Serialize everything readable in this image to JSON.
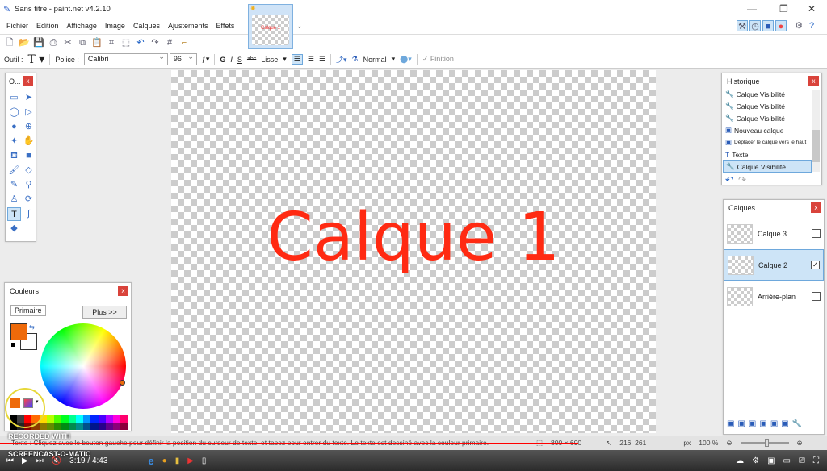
{
  "window": {
    "title": "Sans titre - paint.net v4.2.10",
    "image_tab_label": "Calque 1"
  },
  "menu": [
    "Fichier",
    "Edition",
    "Affichage",
    "Image",
    "Calques",
    "Ajustements",
    "Effets"
  ],
  "toolbar_icons": [
    "new-icon",
    "open-icon",
    "save-icon",
    "print-icon",
    "cut-icon",
    "copy-icon",
    "paste-icon",
    "crop-icon",
    "deselect-icon",
    "undo-icon",
    "redo-icon",
    "grid-icon",
    "ruler-icon"
  ],
  "tool_options": {
    "tool_label": "Outil :",
    "font_label": "Police :",
    "font": "Calibri",
    "size": "96",
    "bold": "G",
    "italic": "I",
    "underline": "S",
    "strike": "abc",
    "antialias": "Lisse",
    "blend": "Normal",
    "finish": "Finition"
  },
  "canvas": {
    "text": "Calque 1",
    "text_color": "#ff2a12"
  },
  "tools": {
    "title": "O...",
    "items": [
      "rectangle-select",
      "move-selection",
      "lasso-select",
      "move-selected",
      "ellipse-select",
      "zoom",
      "magic-wand",
      "pan",
      "paint-bucket",
      "gradient",
      "paintbrush",
      "eraser",
      "pencil",
      "color-picker",
      "clone-stamp",
      "recolor",
      "text",
      "line-curve",
      "shapes"
    ],
    "active": "text"
  },
  "colors": {
    "title": "Couleurs",
    "mode": "Primaire",
    "more": "Plus >>",
    "primary": "#ee6a0a",
    "secondary": "#ffffff",
    "palette": [
      "#000000",
      "#404040",
      "#ff0000",
      "#ff6a00",
      "#ffd800",
      "#b6ff00",
      "#4cff00",
      "#00ff21",
      "#00ff90",
      "#00ffff",
      "#0094ff",
      "#0026ff",
      "#4800ff",
      "#b200ff",
      "#ff00dc",
      "#ff006e"
    ]
  },
  "history": {
    "title": "Historique",
    "items": [
      {
        "icon": "wrench-icon",
        "label": "Calque Visibilité"
      },
      {
        "icon": "wrench-icon",
        "label": "Calque Visibilité"
      },
      {
        "icon": "wrench-icon",
        "label": "Calque Visibilité"
      },
      {
        "icon": "new-layer-icon",
        "label": "Nouveau calque"
      },
      {
        "icon": "move-layer-up-icon",
        "label": "Déplacer le calque vers le haut"
      },
      {
        "icon": "text-icon",
        "label": "Texte"
      },
      {
        "icon": "wrench-icon",
        "label": "Calque Visibilité"
      }
    ],
    "selected": 6
  },
  "layers": {
    "title": "Calques",
    "items": [
      {
        "name": "Calque 3",
        "visible": false
      },
      {
        "name": "Calque 2",
        "visible": true,
        "selected": true
      },
      {
        "name": "Arrière-plan",
        "visible": false
      }
    ]
  },
  "status": {
    "hint": "Texte : Cliquez avec le bouton gauche pour définir la position du curseur de texte, et tapez pour entrer du texte. Le texte est dessiné avec la couleur primaire.",
    "size": "800 × 600",
    "cursor": "216, 261",
    "unit": "px",
    "zoom": "100 %"
  },
  "video": {
    "time": "3:19 / 4:43",
    "progress": 0.75,
    "watermark_top": "RECORDED WITH",
    "watermark_bottom": "SCREENCAST-O-MATIC"
  }
}
